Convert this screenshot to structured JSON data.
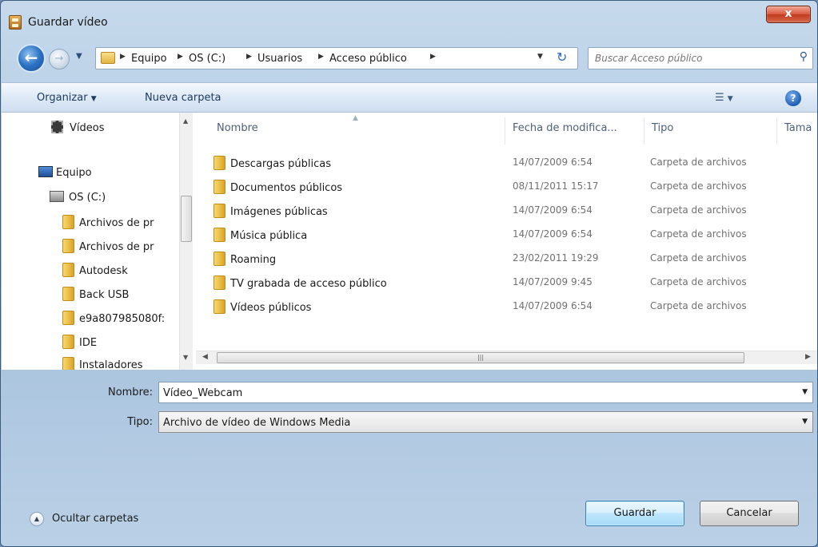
{
  "window": {
    "title": "Guardar vídeo",
    "close_label": "x"
  },
  "address": {
    "crumbs": [
      "Equipo",
      "OS (C:)",
      "Usuarios",
      "Acceso público"
    ],
    "search_placeholder": "Buscar Acceso público"
  },
  "toolbar": {
    "organize": "Organizar",
    "new_folder": "Nueva carpeta"
  },
  "nav": {
    "videos": "Vídeos",
    "computer": "Equipo",
    "drive": "OS (C:)",
    "folders": [
      "Archivos de pr",
      "Archivos de pr",
      "Autodesk",
      "Back USB",
      "e9a807985080f:",
      "IDE",
      "Instaladores"
    ]
  },
  "columns": {
    "name": "Nombre",
    "date": "Fecha de modifica...",
    "type": "Tipo",
    "size": "Tama"
  },
  "files": [
    {
      "name": "Descargas públicas",
      "date": "14/07/2009 6:54",
      "type": "Carpeta de archivos"
    },
    {
      "name": "Documentos públicos",
      "date": "08/11/2011 15:17",
      "type": "Carpeta de archivos"
    },
    {
      "name": "Imágenes públicas",
      "date": "14/07/2009 6:54",
      "type": "Carpeta de archivos"
    },
    {
      "name": "Música pública",
      "date": "14/07/2009 6:54",
      "type": "Carpeta de archivos"
    },
    {
      "name": "Roaming",
      "date": "23/02/2011 19:29",
      "type": "Carpeta de archivos"
    },
    {
      "name": "TV grabada de acceso público",
      "date": "14/07/2009 9:45",
      "type": "Carpeta de archivos"
    },
    {
      "name": "Vídeos públicos",
      "date": "14/07/2009 6:54",
      "type": "Carpeta de archivos"
    }
  ],
  "form": {
    "name_label": "Nombre:",
    "name_value": "Vídeo_Webcam",
    "type_label": "Tipo:",
    "type_value": "Archivo de vídeo de Windows Media"
  },
  "footer": {
    "hide_folders": "Ocultar carpetas",
    "save": "Guardar",
    "cancel": "Cancelar"
  }
}
